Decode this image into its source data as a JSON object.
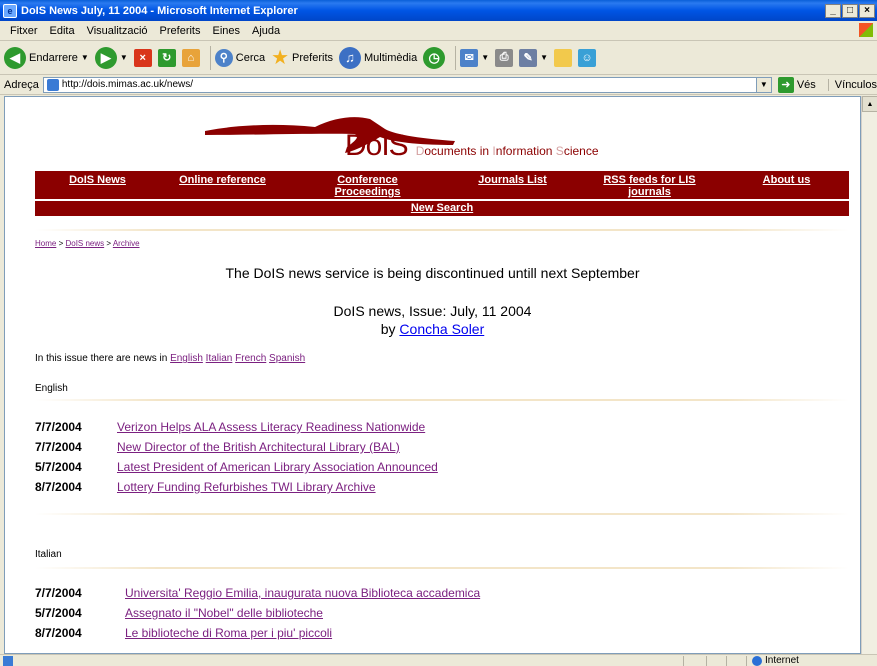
{
  "window": {
    "title": "DoIS News July, 11 2004 - Microsoft Internet Explorer",
    "controls": [
      "_",
      "□",
      "×"
    ]
  },
  "menu": [
    "Fitxer",
    "Edita",
    "Visualització",
    "Preferits",
    "Eines",
    "Ajuda"
  ],
  "toolbar": {
    "back": "Endarrere",
    "search": "Cerca",
    "favorites": "Preferits",
    "media": "Multimèdia"
  },
  "address": {
    "label": "Adreça",
    "url": "http://dois.mimas.ac.uk/news/",
    "go": "Vés",
    "links": "Vínculos"
  },
  "site": {
    "logo_main": "DoIS",
    "logo_sub": [
      "D",
      "ocuments in ",
      "I",
      "nformation ",
      "S",
      "cience"
    ]
  },
  "nav": [
    "DoIS News",
    "Online reference",
    "Conference Proceedings",
    "Journals List",
    "RSS feeds for LIS journals",
    "About us"
  ],
  "nav_search": "New Search",
  "breadcrumb": [
    "Home",
    "DoIS news",
    "Archive"
  ],
  "notice": "The DoIS news service is being discontinued untill next September",
  "issue": {
    "title": "DoIS news, Issue: July, 11 2004",
    "by": "by",
    "author": "Concha Soler"
  },
  "intro": {
    "text": "In this issue there are news in",
    "languages": [
      "English",
      "Italian",
      "French",
      "Spanish"
    ]
  },
  "sections": [
    {
      "label": "English",
      "items": [
        {
          "date": "7/7/2004",
          "title": "Verizon Helps ALA Assess Literacy Readiness Nationwide"
        },
        {
          "date": "7/7/2004",
          "title": "New Director of the British Architectural Library (BAL)"
        },
        {
          "date": "5/7/2004",
          "title": "Latest President of American Library Association Announced"
        },
        {
          "date": "8/7/2004",
          "title": "Lottery Funding Refurbishes TWI Library Archive"
        }
      ]
    },
    {
      "label": "Italian",
      "items": [
        {
          "date": "7/7/2004",
          "title": "Universita' Reggio Emilia, inaugurata nuova Biblioteca accademica"
        },
        {
          "date": "5/7/2004",
          "title": "Assegnato il \"Nobel\" delle biblioteche"
        },
        {
          "date": "8/7/2004",
          "title": "Le biblioteche di Roma per i piu' piccoli"
        }
      ]
    }
  ],
  "status": {
    "zone": "Internet"
  },
  "colors": {
    "nav_bg": "#8b0000",
    "link_visited": "#7b2080",
    "link": "#0000ee"
  }
}
